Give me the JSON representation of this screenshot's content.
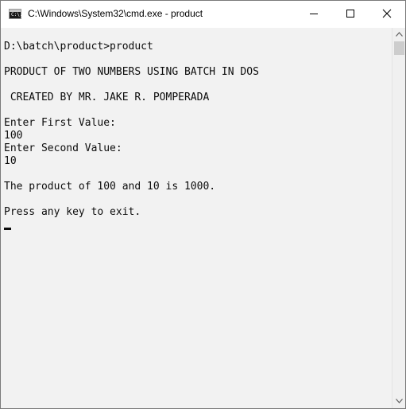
{
  "window": {
    "title": "C:\\Windows\\System32\\cmd.exe - product",
    "icon": "cmd-icon",
    "icon_text": "C:\\."
  },
  "titlebar_buttons": {
    "minimize": "minimize-icon",
    "maximize": "maximize-icon",
    "close": "close-icon"
  },
  "console": {
    "lines": [
      "",
      "D:\\batch\\product>product",
      "",
      "PRODUCT OF TWO NUMBERS USING BATCH IN DOS",
      "",
      " CREATED BY MR. JAKE R. POMPERADA",
      "",
      "Enter First Value:",
      "100",
      "Enter Second Value:",
      "10",
      "",
      "The product of 100 and 10 is 1000.",
      "",
      "Press any key to exit.",
      ""
    ],
    "text_color": "#0c0c0c",
    "background_color": "#f2f2f2"
  },
  "scrollbar": {
    "up_arrow": "scroll-up-arrow-icon",
    "down_arrow": "scroll-down-arrow-icon"
  }
}
